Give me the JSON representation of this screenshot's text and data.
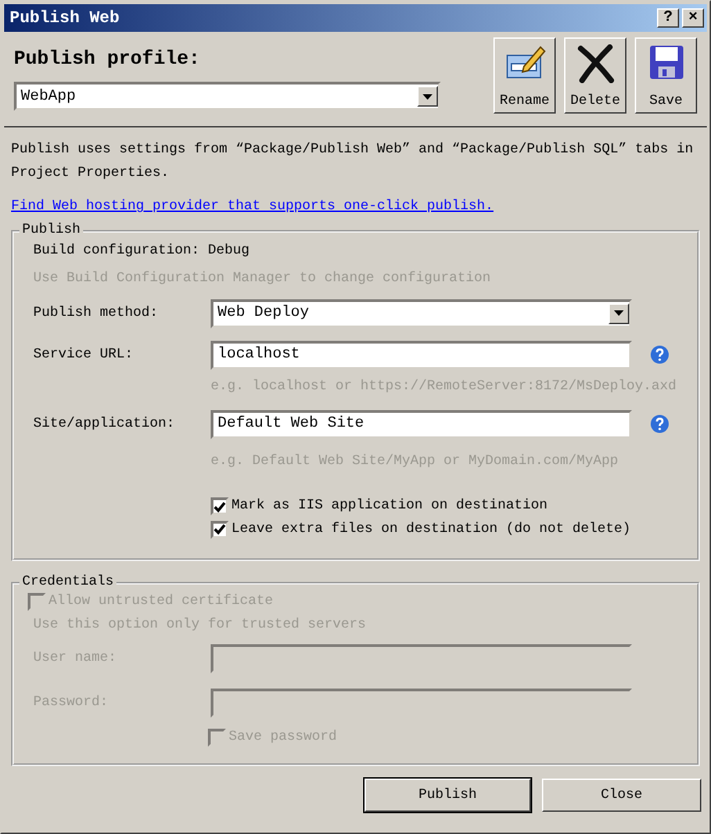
{
  "window": {
    "title": "Publish Web",
    "title_buttons": [
      "?",
      "×"
    ]
  },
  "profile": {
    "label": "Publish profile:",
    "value": "WebApp"
  },
  "toolbar": [
    {
      "kind": "rename",
      "label": "Rename"
    },
    {
      "kind": "delete",
      "label": "Delete"
    },
    {
      "kind": "save",
      "label": "Save"
    }
  ],
  "description": "Publish uses settings from “Package/Publish Web” and “Package/Publish SQL” tabs in Project Properties.",
  "link": "Find Web hosting provider that supports one-click publish.",
  "publish": {
    "legend": "Publish",
    "build_configuration": "Build configuration: Debug",
    "build_hint": "Use Build Configuration Manager to change configuration",
    "method": {
      "label": "Publish method:",
      "value": "Web Deploy"
    },
    "service_url": {
      "label": "Service URL:",
      "value": "localhost",
      "hint": "e.g. localhost or https://RemoteServer:8172/MsDeploy.axd"
    },
    "site": {
      "label": "Site/application:",
      "value": "Default Web Site",
      "hint": "e.g. Default Web Site/MyApp or MyDomain.com/MyApp"
    },
    "options": [
      {
        "label": "Mark as IIS application on destination",
        "checked": true
      },
      {
        "label": "Leave extra files on destination (do not delete)",
        "checked": true
      }
    ]
  },
  "credentials": {
    "legend": "Credentials",
    "disabled": true,
    "allow_untrusted": {
      "label": "Allow untrusted certificate",
      "checked": false
    },
    "hint": "Use this option only for trusted servers",
    "user_name": {
      "label": "User name:"
    },
    "password": {
      "label": "Password:"
    },
    "save_password": {
      "label": "Save password",
      "checked": false
    }
  },
  "buttons": [
    {
      "label": "Publish",
      "default": true
    },
    {
      "label": "Close",
      "default": false
    }
  ]
}
